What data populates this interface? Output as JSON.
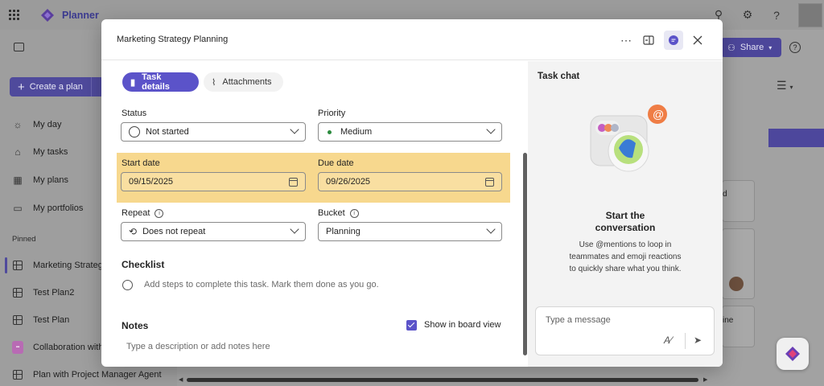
{
  "app": {
    "name": "Planner",
    "create_plan_label": "Create a plan",
    "share_label": "Share",
    "nav": {
      "my_day": "My day",
      "my_tasks": "My tasks",
      "my_plans": "My plans",
      "my_portfolios": "My portfolios",
      "pinned_label": "Pinned",
      "pinned": [
        "Marketing Strategy",
        "Test Plan2",
        "Test Plan",
        "Collaboration with",
        "Plan with Project Manager Agent"
      ]
    },
    "bg_card_fragments": [
      "d",
      "ine"
    ]
  },
  "task": {
    "title": "Marketing Strategy Planning",
    "tabs": {
      "details": "Task details",
      "attachments": "Attachments"
    },
    "status": {
      "label": "Status",
      "value": "Not started"
    },
    "priority": {
      "label": "Priority",
      "value": "Medium",
      "dot_color": "#2b8a3e"
    },
    "start_date": {
      "label": "Start date",
      "value": "09/15/2025"
    },
    "due_date": {
      "label": "Due date",
      "value": "09/26/2025"
    },
    "repeat": {
      "label": "Repeat",
      "value": "Does not repeat"
    },
    "bucket": {
      "label": "Bucket",
      "value": "Planning"
    },
    "checklist": {
      "title": "Checklist",
      "placeholder": "Add steps to complete this task. Mark them done as you go."
    },
    "notes": {
      "title": "Notes",
      "show_in_board_label": "Show in board view",
      "show_in_board_checked": true,
      "placeholder": "Type a description or add notes here"
    },
    "highlight_color": "#f7d88e"
  },
  "chat": {
    "title": "Task chat",
    "start_title": "Start the conversation",
    "start_desc": "Use @mentions to loop in teammates and emoji reactions to quickly share what you think.",
    "input_placeholder": "Type a message"
  },
  "colors": {
    "accent": "#5b53c9",
    "brand": "#4f4a9c"
  }
}
